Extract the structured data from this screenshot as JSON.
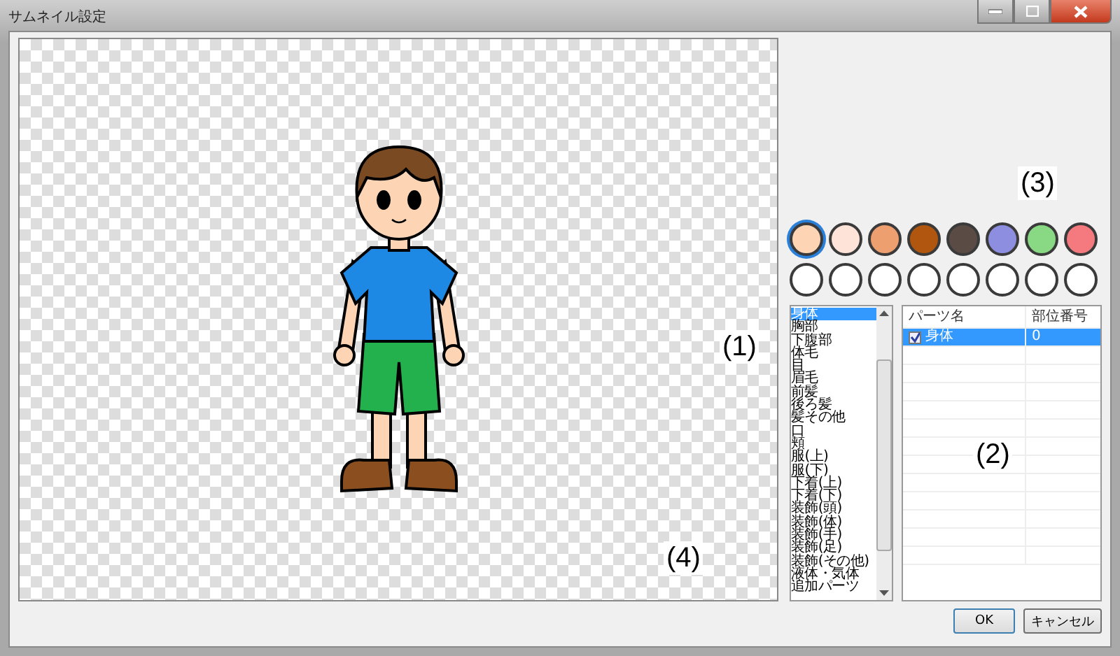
{
  "window": {
    "title": "サムネイル設定"
  },
  "palette": [
    {
      "color": "#fdd5b5",
      "selected": true
    },
    {
      "color": "#fde3d8",
      "selected": false
    },
    {
      "color": "#ee9f70",
      "selected": false
    },
    {
      "color": "#b0560f",
      "selected": false
    },
    {
      "color": "#5a4c44",
      "selected": false
    },
    {
      "color": "#8e8ee0",
      "selected": false
    },
    {
      "color": "#88d884",
      "selected": false
    },
    {
      "color": "#f57a80",
      "selected": false
    },
    {
      "color": "#ffffff",
      "selected": false
    },
    {
      "color": "#ffffff",
      "selected": false
    },
    {
      "color": "#ffffff",
      "selected": false
    },
    {
      "color": "#ffffff",
      "selected": false
    },
    {
      "color": "#ffffff",
      "selected": false
    },
    {
      "color": "#ffffff",
      "selected": false
    },
    {
      "color": "#ffffff",
      "selected": false
    },
    {
      "color": "#ffffff",
      "selected": false
    }
  ],
  "parts_list": [
    {
      "label": "身体",
      "selected": true
    },
    {
      "label": "胸部",
      "selected": false
    },
    {
      "label": "下腹部",
      "selected": false
    },
    {
      "label": "体毛",
      "selected": false
    },
    {
      "label": "目",
      "selected": false
    },
    {
      "label": "眉毛",
      "selected": false
    },
    {
      "label": "前髪",
      "selected": false
    },
    {
      "label": "後ろ髪",
      "selected": false
    },
    {
      "label": "髪その他",
      "selected": false
    },
    {
      "label": "口",
      "selected": false
    },
    {
      "label": "頬",
      "selected": false
    },
    {
      "label": "服(上)",
      "selected": false
    },
    {
      "label": "服(下)",
      "selected": false
    },
    {
      "label": "下着(上)",
      "selected": false
    },
    {
      "label": "下着(下)",
      "selected": false
    },
    {
      "label": "装飾(頭)",
      "selected": false
    },
    {
      "label": "装飾(体)",
      "selected": false
    },
    {
      "label": "装飾(手)",
      "selected": false
    },
    {
      "label": "装飾(足)",
      "selected": false
    },
    {
      "label": "装飾(その他)",
      "selected": false
    },
    {
      "label": "液体・気体",
      "selected": false
    },
    {
      "label": "追加パーツ",
      "selected": false
    }
  ],
  "table": {
    "columns": [
      "パーツ名",
      "部位番号"
    ],
    "rows": [
      {
        "checked": true,
        "selected": true,
        "cells": [
          "身体",
          "0"
        ]
      }
    ]
  },
  "annotations": [
    {
      "kind": "list",
      "label": "(1)"
    },
    {
      "kind": "table",
      "label": "(2)"
    },
    {
      "kind": "palette",
      "label": "(3)"
    },
    {
      "kind": "canvas",
      "label": "(4)"
    }
  ],
  "buttons": [
    "OK",
    "キャンセル"
  ]
}
